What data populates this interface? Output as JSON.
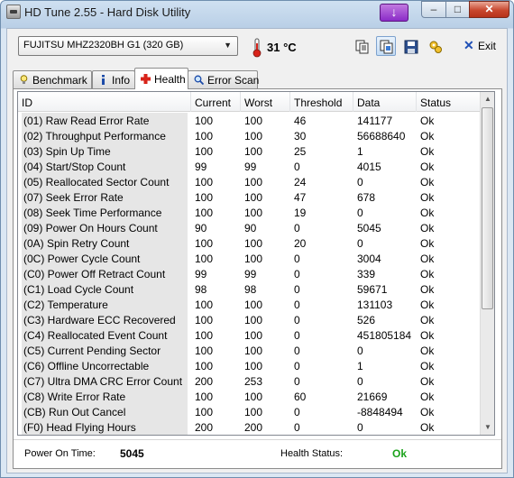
{
  "window": {
    "title": "HD Tune 2.55 - Hard Disk Utility",
    "minimize_glyph": "–",
    "maximize_glyph": "□",
    "close_glyph": "✕",
    "extra_button_glyph": "↓"
  },
  "toolbar": {
    "drive": "FUJITSU MHZ2320BH G1 (320 GB)",
    "temperature": "31 °C",
    "exit_label": "Exit",
    "icons": [
      "copy-text-icon",
      "copy-screenshot-icon",
      "save-icon",
      "options-icon"
    ]
  },
  "tabs": [
    {
      "label": "Benchmark",
      "icon": "lightbulb-icon",
      "active": false
    },
    {
      "label": "Info",
      "icon": "info-icon",
      "active": false
    },
    {
      "label": "Health",
      "icon": "health-cross-icon",
      "active": true
    },
    {
      "label": "Error Scan",
      "icon": "magnifier-icon",
      "active": false
    }
  ],
  "table": {
    "columns": [
      "ID",
      "Current",
      "Worst",
      "Threshold",
      "Data",
      "Status"
    ],
    "rows": [
      [
        "(01) Raw Read Error Rate",
        "100",
        "100",
        "46",
        "141177",
        "Ok"
      ],
      [
        "(02) Throughput Performance",
        "100",
        "100",
        "30",
        "56688640",
        "Ok"
      ],
      [
        "(03) Spin Up Time",
        "100",
        "100",
        "25",
        "1",
        "Ok"
      ],
      [
        "(04) Start/Stop Count",
        "99",
        "99",
        "0",
        "4015",
        "Ok"
      ],
      [
        "(05) Reallocated Sector Count",
        "100",
        "100",
        "24",
        "0",
        "Ok"
      ],
      [
        "(07) Seek Error Rate",
        "100",
        "100",
        "47",
        "678",
        "Ok"
      ],
      [
        "(08) Seek Time Performance",
        "100",
        "100",
        "19",
        "0",
        "Ok"
      ],
      [
        "(09) Power On Hours Count",
        "90",
        "90",
        "0",
        "5045",
        "Ok"
      ],
      [
        "(0A) Spin Retry Count",
        "100",
        "100",
        "20",
        "0",
        "Ok"
      ],
      [
        "(0C) Power Cycle Count",
        "100",
        "100",
        "0",
        "3004",
        "Ok"
      ],
      [
        "(C0) Power Off Retract Count",
        "99",
        "99",
        "0",
        "339",
        "Ok"
      ],
      [
        "(C1) Load Cycle Count",
        "98",
        "98",
        "0",
        "59671",
        "Ok"
      ],
      [
        "(C2) Temperature",
        "100",
        "100",
        "0",
        "131103",
        "Ok"
      ],
      [
        "(C3) Hardware ECC Recovered",
        "100",
        "100",
        "0",
        "526",
        "Ok"
      ],
      [
        "(C4) Reallocated Event Count",
        "100",
        "100",
        "0",
        "451805184",
        "Ok"
      ],
      [
        "(C5) Current Pending Sector",
        "100",
        "100",
        "0",
        "0",
        "Ok"
      ],
      [
        "(C6) Offline Uncorrectable",
        "100",
        "100",
        "0",
        "1",
        "Ok"
      ],
      [
        "(C7) Ultra DMA CRC Error Count",
        "200",
        "253",
        "0",
        "0",
        "Ok"
      ],
      [
        "(C8) Write Error Rate",
        "100",
        "100",
        "60",
        "21669",
        "Ok"
      ],
      [
        "(CB) Run Out Cancel",
        "100",
        "100",
        "0",
        "-8848494",
        "Ok"
      ],
      [
        "(F0) Head Flying Hours",
        "200",
        "200",
        "0",
        "0",
        "Ok"
      ]
    ]
  },
  "footer": {
    "power_on_label": "Power On Time:",
    "power_on_value": "5045",
    "health_label": "Health Status:",
    "health_value": "Ok"
  },
  "colors": {
    "ok_green": "#1ca31c",
    "id_column_bg": "#e6e6e6",
    "close_red": "#c8472e"
  }
}
